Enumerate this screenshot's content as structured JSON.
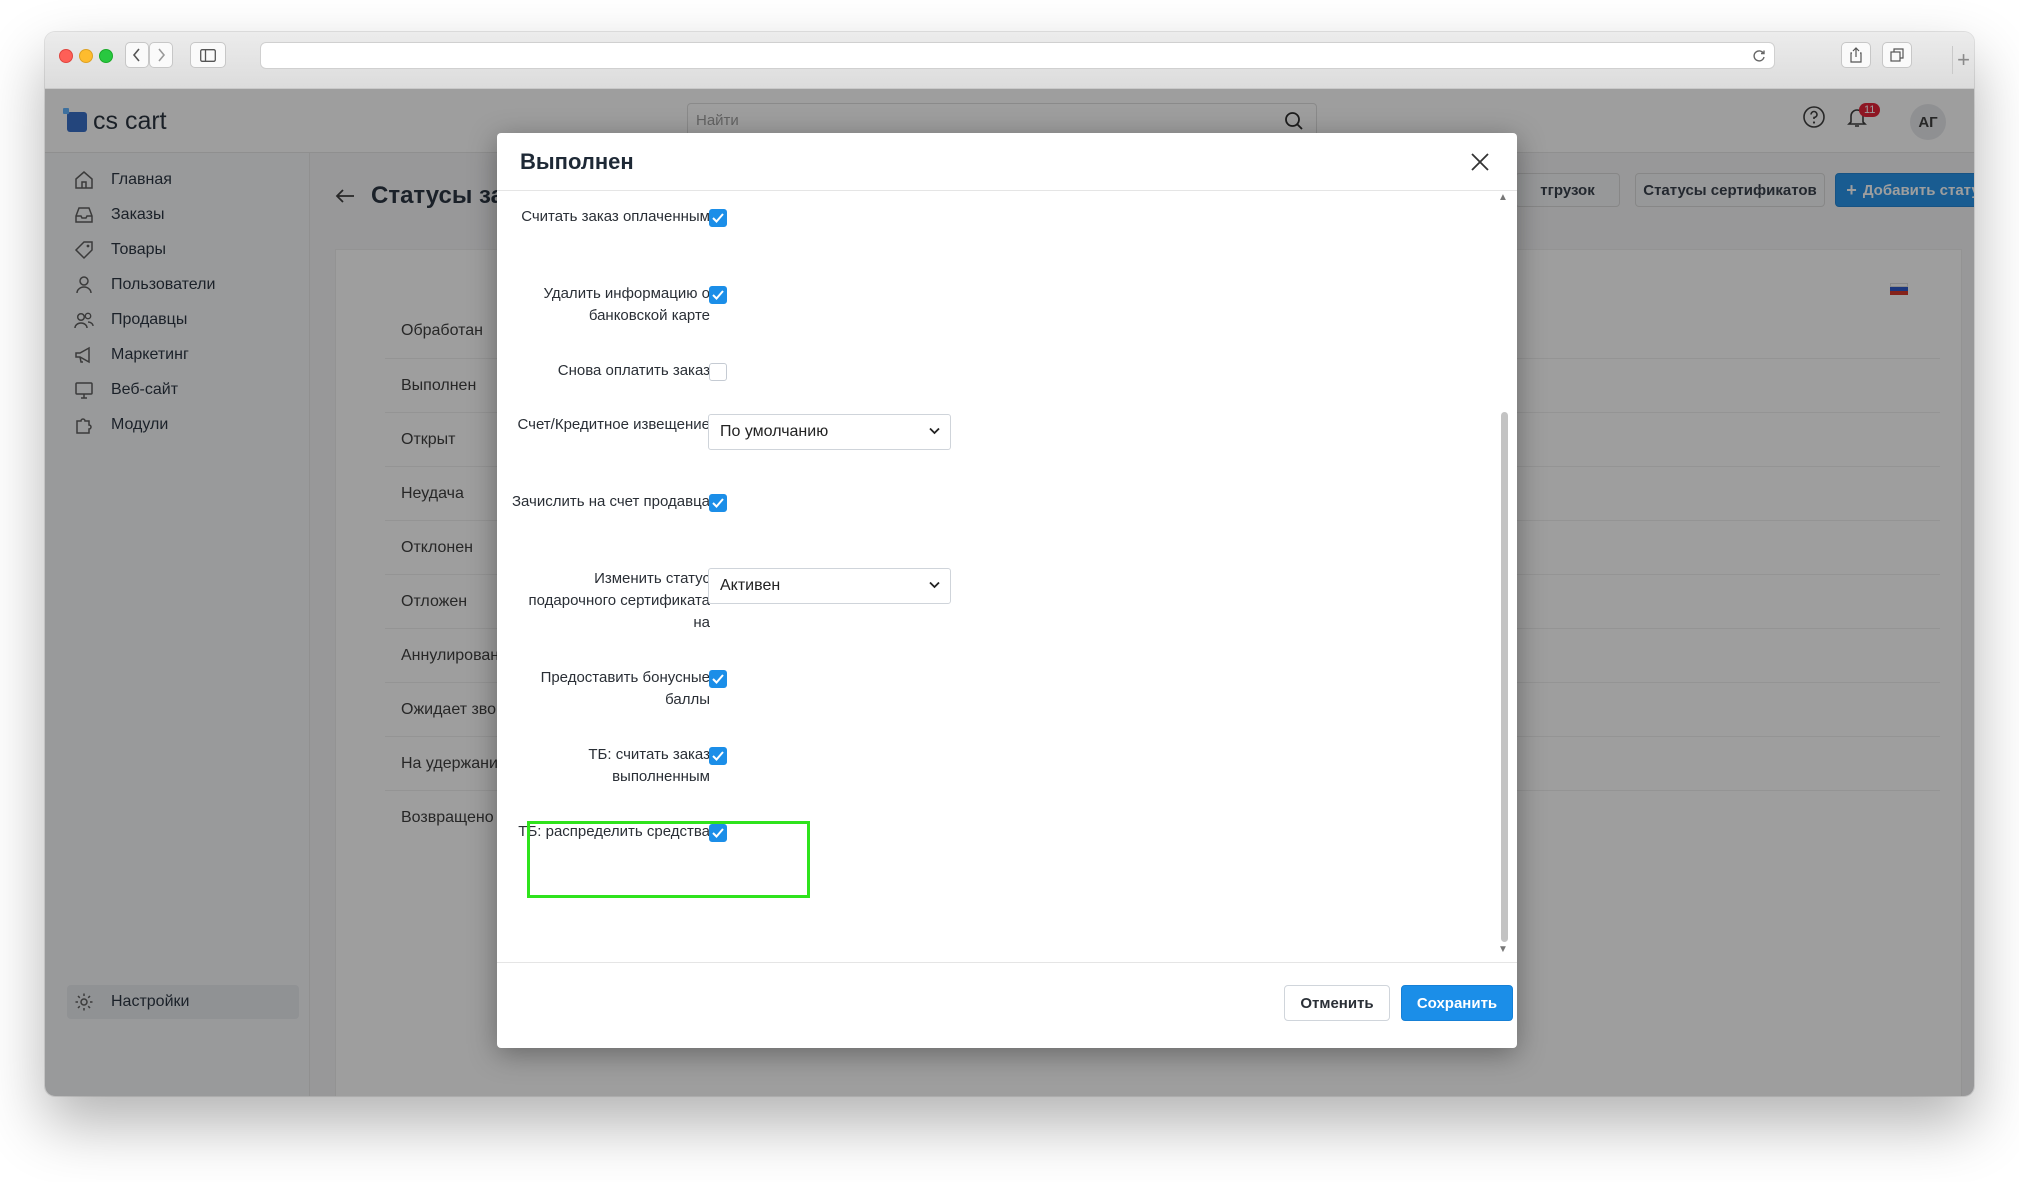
{
  "app": {
    "logo_text": "cs cart",
    "search_placeholder": "Найти",
    "notifications_count": "11",
    "avatar_initials": "АГ"
  },
  "sidebar": {
    "items": [
      {
        "label": "Главная",
        "icon": "home-icon"
      },
      {
        "label": "Заказы",
        "icon": "inbox-icon"
      },
      {
        "label": "Товары",
        "icon": "tag-icon"
      },
      {
        "label": "Пользователи",
        "icon": "user-icon"
      },
      {
        "label": "Продавцы",
        "icon": "users-icon"
      },
      {
        "label": "Маркетинг",
        "icon": "megaphone-icon"
      },
      {
        "label": "Веб-сайт",
        "icon": "monitor-icon"
      },
      {
        "label": "Модули",
        "icon": "puzzle-icon"
      }
    ],
    "settings_label": "Настройки"
  },
  "page": {
    "title": "Статусы зак",
    "btn_shipments_partial": "тгрузок",
    "btn_certificates": "Статусы сертификатов",
    "btn_add_status": "Добавить статус",
    "statuses": [
      "Обработан",
      "Выполнен",
      "Открыт",
      "Неудача",
      "Отклонен",
      "Отложен",
      "Аннулирован",
      "Ожидает звонка",
      "На удержании",
      "Возвращено"
    ]
  },
  "modal": {
    "title": "Выполнен",
    "fields": [
      {
        "label": "Считать заказ оплаченным",
        "type": "checkbox",
        "checked": true
      },
      {
        "label": "Удалить информацию о банковской карте",
        "type": "checkbox",
        "checked": true
      },
      {
        "label": "Снова оплатить заказ",
        "type": "checkbox",
        "checked": false
      },
      {
        "label": "Счет/Кредитное извещение",
        "type": "select",
        "value": "По умолчанию"
      },
      {
        "label": "Зачислить на счет продавца",
        "type": "checkbox",
        "checked": true
      },
      {
        "label": "Изменить статус подарочного сертификата на",
        "type": "select",
        "value": "Активен"
      },
      {
        "label": "Предоставить бонусные баллы",
        "type": "checkbox",
        "checked": true
      },
      {
        "label": "ТБ: считать заказ выполненным",
        "type": "checkbox",
        "checked": true
      },
      {
        "label": "ТБ: распределить средства",
        "type": "checkbox",
        "checked": true,
        "highlighted": true
      }
    ],
    "cancel_label": "Отменить",
    "save_label": "Сохранить"
  },
  "colors": {
    "accent": "#1b8ee8",
    "highlight": "#2fe31c",
    "badge": "#e4162b"
  }
}
